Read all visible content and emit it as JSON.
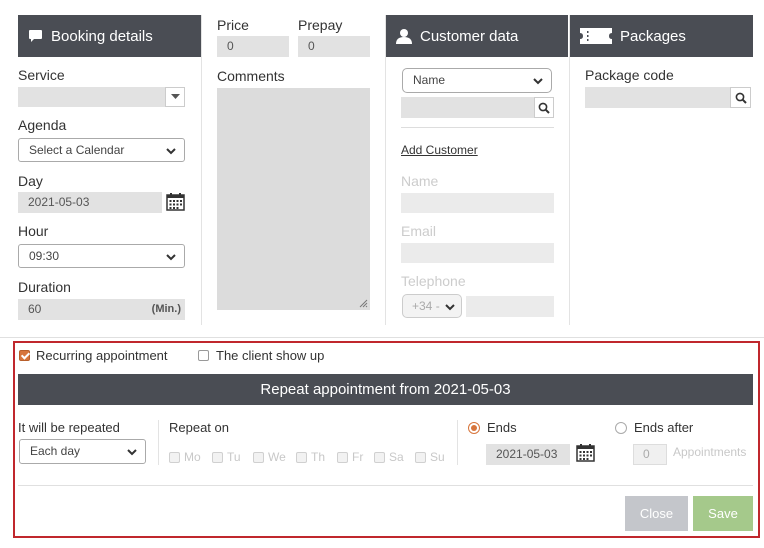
{
  "booking": {
    "title": "Booking details",
    "service_label": "Service",
    "service_value": "",
    "agenda_label": "Agenda",
    "agenda_value": "Select a Calendar",
    "day_label": "Day",
    "day_value": "2021-05-03",
    "hour_label": "Hour",
    "hour_value": "09:30",
    "duration_label": "Duration",
    "duration_value": "60",
    "duration_unit": "(Min.)"
  },
  "pricing": {
    "price_label": "Price",
    "price_value": "0",
    "prepay_label": "Prepay",
    "prepay_value": "0",
    "comments_label": "Comments",
    "comments_value": ""
  },
  "customer": {
    "title": "Customer data",
    "search_by": "Name",
    "search_value": "",
    "add_customer": "Add Customer",
    "name_label": "Name",
    "email_label": "Email",
    "telephone_label": "Telephone",
    "phone_prefix": "+34 -"
  },
  "packages": {
    "title": "Packages",
    "code_label": "Package code",
    "code_value": ""
  },
  "recurring": {
    "recurring_label": "Recurring appointment",
    "recurring_checked": true,
    "showup_label": "The client show up",
    "showup_checked": false,
    "banner": "Repeat appointment from 2021-05-03",
    "repeated_label": "It will be repeated",
    "repeated_value": "Each day",
    "repeat_on_label": "Repeat on",
    "days": [
      "Mo",
      "Tu",
      "We",
      "Th",
      "Fr",
      "Sa",
      "Su"
    ],
    "ends_label": "Ends",
    "ends_date": "2021-05-03",
    "ends_after_label": "Ends after",
    "ends_after_value": "0",
    "appointments_label": "Appointments"
  },
  "actions": {
    "close": "Close",
    "save": "Save"
  },
  "colors": {
    "header_bg": "#4a4d54",
    "accent": "#d7753c",
    "save_bg": "#a5c98b",
    "close_bg": "#c4c6cb",
    "border_red": "#c0272d"
  }
}
